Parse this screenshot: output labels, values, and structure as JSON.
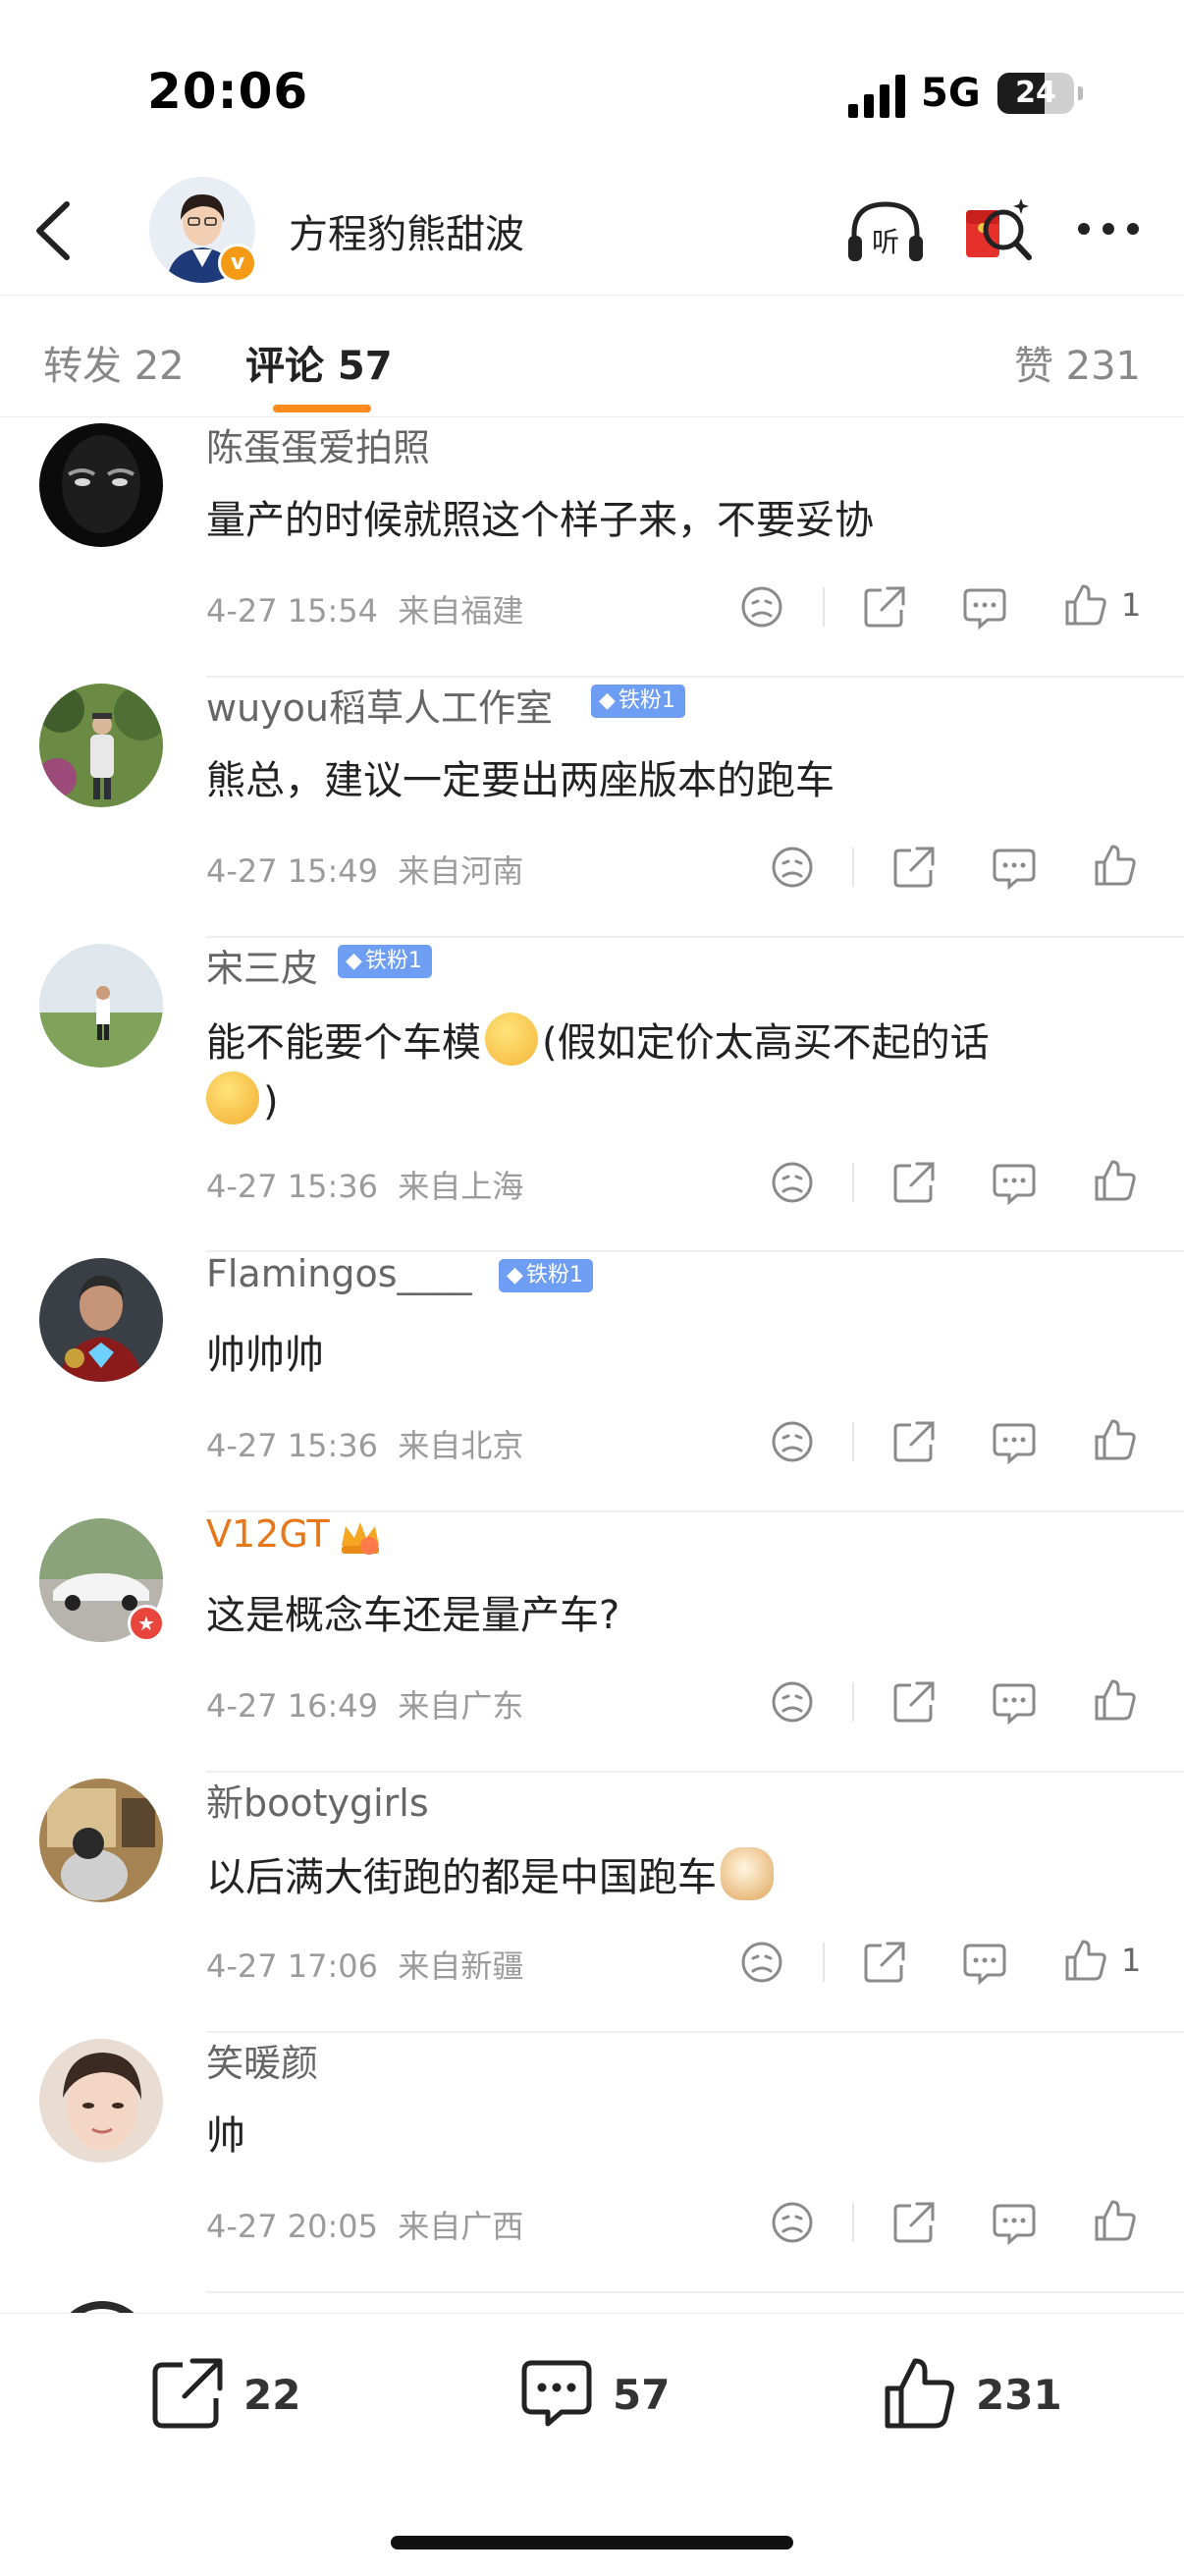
{
  "status_bar": {
    "time": "20:06",
    "network": "5G",
    "battery": "24"
  },
  "header": {
    "name": "方程豹熊甜波"
  },
  "tabs": {
    "repost": "转发 22",
    "comment": "评论 57",
    "like": "赞 231"
  },
  "comments": [
    {
      "name": "陈蛋蛋爱拍照",
      "text": "量产的时候就照这个样子来，不要妥协",
      "time": "4-27 15:54",
      "location": "来自福建",
      "likes": "1"
    },
    {
      "name": "wuyou稻草人工作室",
      "badge": "铁粉1",
      "text": "熊总，建议一定要出两座版本的跑车",
      "time": "4-27 15:49",
      "location": "来自河南"
    },
    {
      "name": "宋三皮",
      "badge": "铁粉1",
      "text_a": "能不能要个车模",
      "text_b": "(假如定价太高买不起的话",
      "text_c": ")",
      "time": "4-27 15:36",
      "location": "来自上海"
    },
    {
      "name": "Flamingos____",
      "badge": "铁粉1",
      "text": "帅帅帅",
      "time": "4-27 15:36",
      "location": "来自北京"
    },
    {
      "name": "V12GT",
      "text": "这是概念车还是量产车?",
      "time": "4-27 16:49",
      "location": "来自广东"
    },
    {
      "name": "新bootygirls",
      "text": "以后满大街跑的都是中国跑车",
      "time": "4-27 17:06",
      "location": "来自新疆",
      "likes": "1"
    },
    {
      "name": "笑暖颜",
      "text": "帅",
      "time": "4-27 20:05",
      "location": "来自广西"
    }
  ],
  "bottom_bar": {
    "repost_count": "22",
    "comment_count": "57",
    "like_count": "231"
  },
  "colors": {
    "accent": "#ff8a1f",
    "vip_name": "#e8771a",
    "badge": "#6e9ef4"
  }
}
